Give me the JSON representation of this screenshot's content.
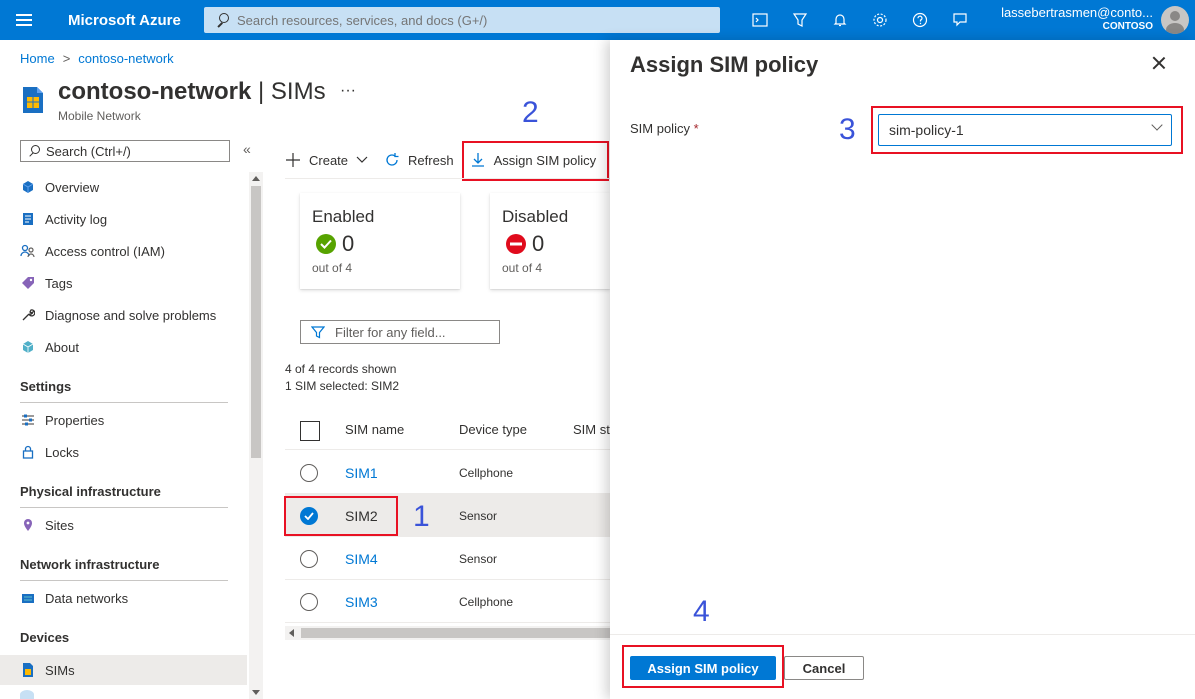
{
  "header": {
    "brand": "Microsoft Azure",
    "search_placeholder": "Search resources, services, and docs (G+/)",
    "user_name": "lassebertrasmen@conto...",
    "tenant": "CONTOSO"
  },
  "breadcrumb": {
    "home": "Home",
    "resource": "contoso-network"
  },
  "page": {
    "title_resource": "contoso-network",
    "title_section": "SIMs",
    "subtitle": "Mobile Network"
  },
  "sidebar": {
    "search_placeholder": "Search (Ctrl+/)",
    "top_items": [
      "Overview",
      "Activity log",
      "Access control (IAM)",
      "Tags",
      "Diagnose and solve problems",
      "About"
    ],
    "sections": [
      {
        "title": "Settings",
        "items": [
          "Properties",
          "Locks"
        ]
      },
      {
        "title": "Physical infrastructure",
        "items": [
          "Sites"
        ]
      },
      {
        "title": "Network infrastructure",
        "items": [
          "Data networks"
        ]
      },
      {
        "title": "Devices",
        "items": [
          "SIMs"
        ]
      }
    ]
  },
  "toolbar": {
    "create": "Create",
    "refresh": "Refresh",
    "assign": "Assign SIM policy"
  },
  "cards": [
    {
      "title": "Enabled",
      "value": "0",
      "sub": "out of 4",
      "status": "success"
    },
    {
      "title": "Disabled",
      "value": "0",
      "sub": "out of 4",
      "status": "blocked"
    }
  ],
  "filter_placeholder": "Filter for any field...",
  "records": {
    "shown": "4 of 4 records shown",
    "selected": "1 SIM selected: SIM2"
  },
  "grid": {
    "columns": [
      "SIM name",
      "Device type",
      "SIM st"
    ],
    "rows": [
      {
        "name": "SIM1",
        "device": "Cellphone",
        "selected": false
      },
      {
        "name": "SIM2",
        "device": "Sensor",
        "selected": true
      },
      {
        "name": "SIM4",
        "device": "Sensor",
        "selected": false
      },
      {
        "name": "SIM3",
        "device": "Cellphone",
        "selected": false
      }
    ]
  },
  "steps": [
    "1",
    "2",
    "3",
    "4"
  ],
  "panel": {
    "title": "Assign SIM policy",
    "field_label": "SIM policy",
    "required_mark": "*",
    "selected_policy": "sim-policy-1",
    "primary_button": "Assign SIM policy",
    "cancel_button": "Cancel"
  },
  "colors": {
    "accent": "#0078d4",
    "annotation_red": "#e81123",
    "annotation_blue": "#3a53d9"
  }
}
